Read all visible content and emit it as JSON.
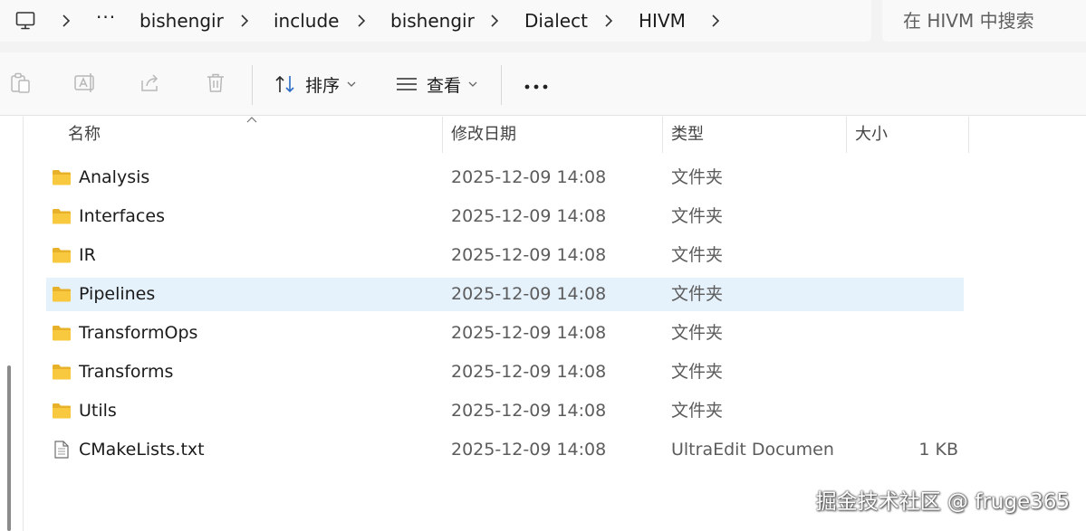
{
  "breadcrumb": {
    "items": [
      "bishengir",
      "include",
      "bishengir",
      "Dialect",
      "HIVM"
    ],
    "overflow_label": "···"
  },
  "search": {
    "placeholder": "在 HIVM 中搜索"
  },
  "toolbar": {
    "sort_label": "排序",
    "view_label": "查看",
    "more_label": "···"
  },
  "columns": {
    "name": "名称",
    "modified": "修改日期",
    "type": "类型",
    "size": "大小"
  },
  "files": [
    {
      "name": "Analysis",
      "date": "2025-12-09 14:08",
      "type": "文件夹",
      "size": "",
      "icon": "folder-icon",
      "selected": false
    },
    {
      "name": "Interfaces",
      "date": "2025-12-09 14:08",
      "type": "文件夹",
      "size": "",
      "icon": "folder-icon",
      "selected": false
    },
    {
      "name": "IR",
      "date": "2025-12-09 14:08",
      "type": "文件夹",
      "size": "",
      "icon": "folder-icon",
      "selected": false
    },
    {
      "name": "Pipelines",
      "date": "2025-12-09 14:08",
      "type": "文件夹",
      "size": "",
      "icon": "folder-icon",
      "selected": true
    },
    {
      "name": "TransformOps",
      "date": "2025-12-09 14:08",
      "type": "文件夹",
      "size": "",
      "icon": "folder-icon",
      "selected": false
    },
    {
      "name": "Transforms",
      "date": "2025-12-09 14:08",
      "type": "文件夹",
      "size": "",
      "icon": "folder-icon",
      "selected": false
    },
    {
      "name": "Utils",
      "date": "2025-12-09 14:08",
      "type": "文件夹",
      "size": "",
      "icon": "folder-icon",
      "selected": false
    },
    {
      "name": "CMakeLists.txt",
      "date": "2025-12-09 14:08",
      "type": "UltraEdit Documen...",
      "size": "1 KB",
      "icon": "text-file-icon",
      "selected": false
    }
  ],
  "watermark": "掘金技术社区 @ fruge365",
  "colors": {
    "selection": "#e5f1fb",
    "folder": "#f8c83f",
    "folder_dark": "#e8b12a"
  }
}
